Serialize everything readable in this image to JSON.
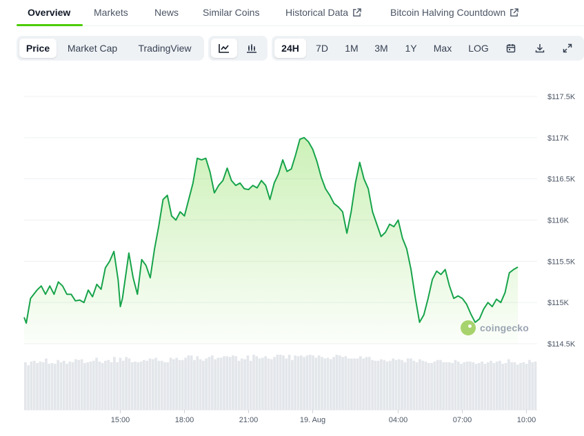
{
  "tabs": [
    {
      "label": "Overview",
      "active": true
    },
    {
      "label": "Markets"
    },
    {
      "label": "News"
    },
    {
      "label": "Similar Coins"
    },
    {
      "label": "Historical Data",
      "external": true
    },
    {
      "label": "Bitcoin Halving Countdown",
      "external": true
    }
  ],
  "view_toggle": [
    "Price",
    "Market Cap",
    "TradingView"
  ],
  "chart_style_icons": [
    "line-chart-icon",
    "candlestick-icon"
  ],
  "ranges": [
    "24H",
    "7D",
    "1M",
    "3M",
    "1Y",
    "Max",
    "LOG"
  ],
  "tool_icons": [
    "calendar-icon",
    "download-icon",
    "expand-icon"
  ],
  "watermark": "coingecko",
  "colors": {
    "accent": "#4bcc00",
    "line": "#16a34a",
    "volume": "#e3e6ea"
  },
  "chart_data": {
    "type": "area",
    "y_tick_labels": [
      "$117.5K",
      "$117K",
      "$116.5K",
      "$116K",
      "$115.5K",
      "$115K",
      "$114.5K"
    ],
    "y_ticks": [
      117500,
      117000,
      116500,
      116000,
      115500,
      115000,
      114500
    ],
    "ylim": [
      114500,
      117500
    ],
    "x_tick_labels": [
      "15:00",
      "18:00",
      "21:00",
      "19. Aug",
      "04:00",
      "07:00",
      "10:00"
    ],
    "x_ticks_hours": [
      15,
      18,
      21,
      24,
      28,
      31,
      34
    ],
    "xlim_hours": [
      10.5,
      34.5
    ],
    "series": [
      {
        "values": [
          [
            10.5,
            114820
          ],
          [
            10.6,
            114750
          ],
          [
            10.8,
            115050
          ],
          [
            11.1,
            115150
          ],
          [
            11.3,
            115200
          ],
          [
            11.5,
            115100
          ],
          [
            11.7,
            115200
          ],
          [
            11.9,
            115100
          ],
          [
            12.1,
            115250
          ],
          [
            12.3,
            115200
          ],
          [
            12.5,
            115100
          ],
          [
            12.7,
            115100
          ],
          [
            12.9,
            115020
          ],
          [
            13.1,
            115030
          ],
          [
            13.3,
            115000
          ],
          [
            13.5,
            115150
          ],
          [
            13.7,
            115070
          ],
          [
            13.9,
            115220
          ],
          [
            14.1,
            115160
          ],
          [
            14.3,
            115420
          ],
          [
            14.5,
            115500
          ],
          [
            14.7,
            115620
          ],
          [
            14.9,
            115270
          ],
          [
            15.0,
            114950
          ],
          [
            15.1,
            115050
          ],
          [
            15.4,
            115600
          ],
          [
            15.6,
            115300
          ],
          [
            15.8,
            115100
          ],
          [
            16.0,
            115520
          ],
          [
            16.2,
            115450
          ],
          [
            16.4,
            115300
          ],
          [
            16.6,
            115650
          ],
          [
            16.8,
            115930
          ],
          [
            17.0,
            116250
          ],
          [
            17.2,
            116300
          ],
          [
            17.4,
            116050
          ],
          [
            17.6,
            116000
          ],
          [
            17.8,
            116100
          ],
          [
            18.0,
            116050
          ],
          [
            18.2,
            116250
          ],
          [
            18.4,
            116450
          ],
          [
            18.6,
            116750
          ],
          [
            18.8,
            116730
          ],
          [
            19.0,
            116750
          ],
          [
            19.2,
            116580
          ],
          [
            19.4,
            116330
          ],
          [
            19.6,
            116420
          ],
          [
            19.8,
            116480
          ],
          [
            20.0,
            116630
          ],
          [
            20.2,
            116480
          ],
          [
            20.4,
            116420
          ],
          [
            20.6,
            116450
          ],
          [
            20.8,
            116380
          ],
          [
            21.0,
            116370
          ],
          [
            21.2,
            116420
          ],
          [
            21.4,
            116390
          ],
          [
            21.6,
            116480
          ],
          [
            21.8,
            116420
          ],
          [
            22.0,
            116250
          ],
          [
            22.2,
            116450
          ],
          [
            22.4,
            116560
          ],
          [
            22.6,
            116730
          ],
          [
            22.8,
            116590
          ],
          [
            23.0,
            116620
          ],
          [
            23.2,
            116790
          ],
          [
            23.4,
            116980
          ],
          [
            23.6,
            117000
          ],
          [
            23.8,
            116950
          ],
          [
            24.0,
            116860
          ],
          [
            24.2,
            116710
          ],
          [
            24.4,
            116520
          ],
          [
            24.6,
            116380
          ],
          [
            24.8,
            116300
          ],
          [
            25.0,
            116200
          ],
          [
            25.2,
            116160
          ],
          [
            25.4,
            116100
          ],
          [
            25.6,
            115840
          ],
          [
            25.8,
            116100
          ],
          [
            26.0,
            116450
          ],
          [
            26.2,
            116700
          ],
          [
            26.4,
            116500
          ],
          [
            26.6,
            116380
          ],
          [
            26.8,
            116100
          ],
          [
            27.0,
            115950
          ],
          [
            27.2,
            115800
          ],
          [
            27.4,
            115850
          ],
          [
            27.6,
            115950
          ],
          [
            27.8,
            115920
          ],
          [
            28.0,
            116000
          ],
          [
            28.2,
            115780
          ],
          [
            28.4,
            115650
          ],
          [
            28.6,
            115400
          ],
          [
            28.8,
            115060
          ],
          [
            29.0,
            114760
          ],
          [
            29.2,
            114850
          ],
          [
            29.4,
            115050
          ],
          [
            29.6,
            115280
          ],
          [
            29.8,
            115380
          ],
          [
            30.0,
            115340
          ],
          [
            30.2,
            115400
          ],
          [
            30.4,
            115200
          ],
          [
            30.6,
            115050
          ],
          [
            30.8,
            115080
          ],
          [
            31.0,
            115050
          ],
          [
            31.2,
            114980
          ],
          [
            31.4,
            114860
          ],
          [
            31.6,
            114760
          ],
          [
            31.8,
            114800
          ],
          [
            32.0,
            114920
          ],
          [
            32.2,
            115000
          ],
          [
            32.4,
            114950
          ],
          [
            32.6,
            115040
          ],
          [
            32.8,
            115000
          ],
          [
            33.0,
            115120
          ],
          [
            33.2,
            115360
          ],
          [
            33.4,
            115400
          ],
          [
            33.6,
            115430
          ]
        ]
      }
    ],
    "volume": [
      63,
      59,
      64,
      65,
      62,
      64,
      63,
      68,
      61,
      62,
      61,
      66,
      63,
      65,
      61,
      64,
      63,
      67,
      66,
      67,
      62,
      63,
      64,
      65,
      69,
      64,
      62,
      65,
      66,
      63,
      70,
      63,
      69,
      65,
      70,
      68,
      63,
      64,
      63,
      64,
      66,
      65,
      68,
      67,
      69,
      65,
      65,
      63,
      63,
      69,
      67,
      69,
      66,
      66,
      69,
      72,
      72,
      66,
      71,
      67,
      65,
      68,
      70,
      72,
      67,
      69,
      69,
      71,
      71,
      70,
      72,
      71,
      65,
      68,
      67,
      72,
      65,
      73,
      71,
      68,
      69,
      71,
      68,
      67,
      70,
      73,
      73,
      72,
      68,
      73,
      66,
      72,
      71,
      72,
      70,
      72,
      73,
      72,
      69,
      72,
      70,
      68,
      69,
      67,
      70,
      73,
      72,
      70,
      71,
      68,
      68,
      68,
      68,
      71,
      68,
      70,
      70,
      66,
      65,
      65,
      67,
      66,
      64,
      65,
      68,
      66,
      67,
      66,
      63,
      68,
      68,
      65,
      63,
      67,
      65,
      64,
      62,
      62,
      64,
      66,
      66,
      63,
      63,
      63,
      62,
      66,
      64,
      61,
      63,
      64,
      64,
      63,
      61,
      62,
      64,
      61,
      63,
      65,
      62,
      64,
      65,
      61,
      62,
      67,
      63,
      63,
      60,
      62,
      63,
      61,
      66,
      63,
      64
    ]
  }
}
